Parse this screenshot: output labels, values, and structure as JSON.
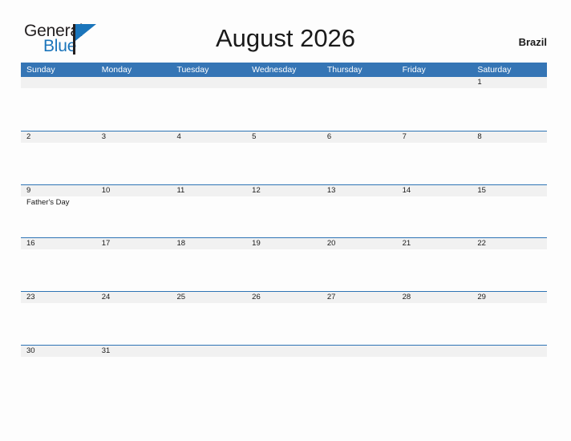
{
  "brand": {
    "name_part1": "General",
    "name_part2": "Blue",
    "color_dark": "#231f20",
    "color_blue": "#1b75bb"
  },
  "header": {
    "title": "August 2026",
    "region": "Brazil"
  },
  "theme": {
    "header_blue": "#3575b5",
    "rule_blue": "#2e74b5",
    "band_gray": "#f1f1f1",
    "page_bg": "#fdfdfd",
    "text_dark": "#1a1a1a"
  },
  "calendar": {
    "weekdays": [
      "Sunday",
      "Monday",
      "Tuesday",
      "Wednesday",
      "Thursday",
      "Friday",
      "Saturday"
    ],
    "weeks": [
      {
        "days": [
          {
            "date": "",
            "events": []
          },
          {
            "date": "",
            "events": []
          },
          {
            "date": "",
            "events": []
          },
          {
            "date": "",
            "events": []
          },
          {
            "date": "",
            "events": []
          },
          {
            "date": "",
            "events": []
          },
          {
            "date": "1",
            "events": []
          }
        ]
      },
      {
        "days": [
          {
            "date": "2",
            "events": []
          },
          {
            "date": "3",
            "events": []
          },
          {
            "date": "4",
            "events": []
          },
          {
            "date": "5",
            "events": []
          },
          {
            "date": "6",
            "events": []
          },
          {
            "date": "7",
            "events": []
          },
          {
            "date": "8",
            "events": []
          }
        ]
      },
      {
        "days": [
          {
            "date": "9",
            "events": [
              "Father's Day"
            ]
          },
          {
            "date": "10",
            "events": []
          },
          {
            "date": "11",
            "events": []
          },
          {
            "date": "12",
            "events": []
          },
          {
            "date": "13",
            "events": []
          },
          {
            "date": "14",
            "events": []
          },
          {
            "date": "15",
            "events": []
          }
        ]
      },
      {
        "days": [
          {
            "date": "16",
            "events": []
          },
          {
            "date": "17",
            "events": []
          },
          {
            "date": "18",
            "events": []
          },
          {
            "date": "19",
            "events": []
          },
          {
            "date": "20",
            "events": []
          },
          {
            "date": "21",
            "events": []
          },
          {
            "date": "22",
            "events": []
          }
        ]
      },
      {
        "days": [
          {
            "date": "23",
            "events": []
          },
          {
            "date": "24",
            "events": []
          },
          {
            "date": "25",
            "events": []
          },
          {
            "date": "26",
            "events": []
          },
          {
            "date": "27",
            "events": []
          },
          {
            "date": "28",
            "events": []
          },
          {
            "date": "29",
            "events": []
          }
        ]
      },
      {
        "days": [
          {
            "date": "30",
            "events": []
          },
          {
            "date": "31",
            "events": []
          },
          {
            "date": "",
            "events": []
          },
          {
            "date": "",
            "events": []
          },
          {
            "date": "",
            "events": []
          },
          {
            "date": "",
            "events": []
          },
          {
            "date": "",
            "events": []
          }
        ]
      }
    ]
  }
}
